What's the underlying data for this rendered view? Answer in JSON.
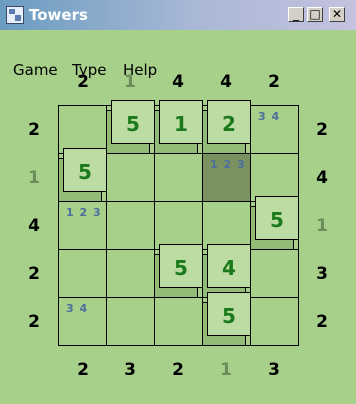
{
  "window": {
    "title": "Towers"
  },
  "menu": {
    "game": "Game",
    "type": "Type",
    "help": "Help"
  },
  "clues": {
    "top": [
      "2",
      "1",
      "4",
      "4",
      "2"
    ],
    "bottom": [
      "2",
      "3",
      "2",
      "1",
      "3"
    ],
    "left": [
      "2",
      "1",
      "4",
      "2",
      "2"
    ],
    "right": [
      "2",
      "4",
      "1",
      "3",
      "2"
    ],
    "top_satisfied": [
      false,
      true,
      false,
      false,
      false
    ],
    "bottom_satisfied": [
      false,
      false,
      false,
      true,
      false
    ],
    "left_satisfied": [
      false,
      true,
      false,
      false,
      false
    ],
    "right_satisfied": [
      false,
      false,
      true,
      false,
      false
    ]
  },
  "colors": {
    "clue": "#000000",
    "clue_done": "#6c8c5c",
    "value": "#1a7a1a",
    "pencil": "#4d6e9e",
    "highlight": "#7a9160"
  },
  "grid": {
    "size": 5,
    "cells": [
      [
        {
          "v": ""
        },
        {
          "v": "5"
        },
        {
          "v": "1"
        },
        {
          "v": "2"
        },
        {
          "v": "",
          "pm": "3 4"
        }
      ],
      [
        {
          "v": "5"
        },
        {
          "v": ""
        },
        {
          "v": ""
        },
        {
          "v": "",
          "pm": "1 2 3",
          "hl": true
        },
        {
          "v": ""
        }
      ],
      [
        {
          "v": "",
          "pm": "1 2 3"
        },
        {
          "v": ""
        },
        {
          "v": ""
        },
        {
          "v": ""
        },
        {
          "v": "5"
        }
      ],
      [
        {
          "v": ""
        },
        {
          "v": ""
        },
        {
          "v": "5"
        },
        {
          "v": "4"
        },
        {
          "v": ""
        }
      ],
      [
        {
          "v": "",
          "pm": "3 4"
        },
        {
          "v": ""
        },
        {
          "v": ""
        },
        {
          "v": "5"
        },
        {
          "v": ""
        }
      ]
    ]
  }
}
